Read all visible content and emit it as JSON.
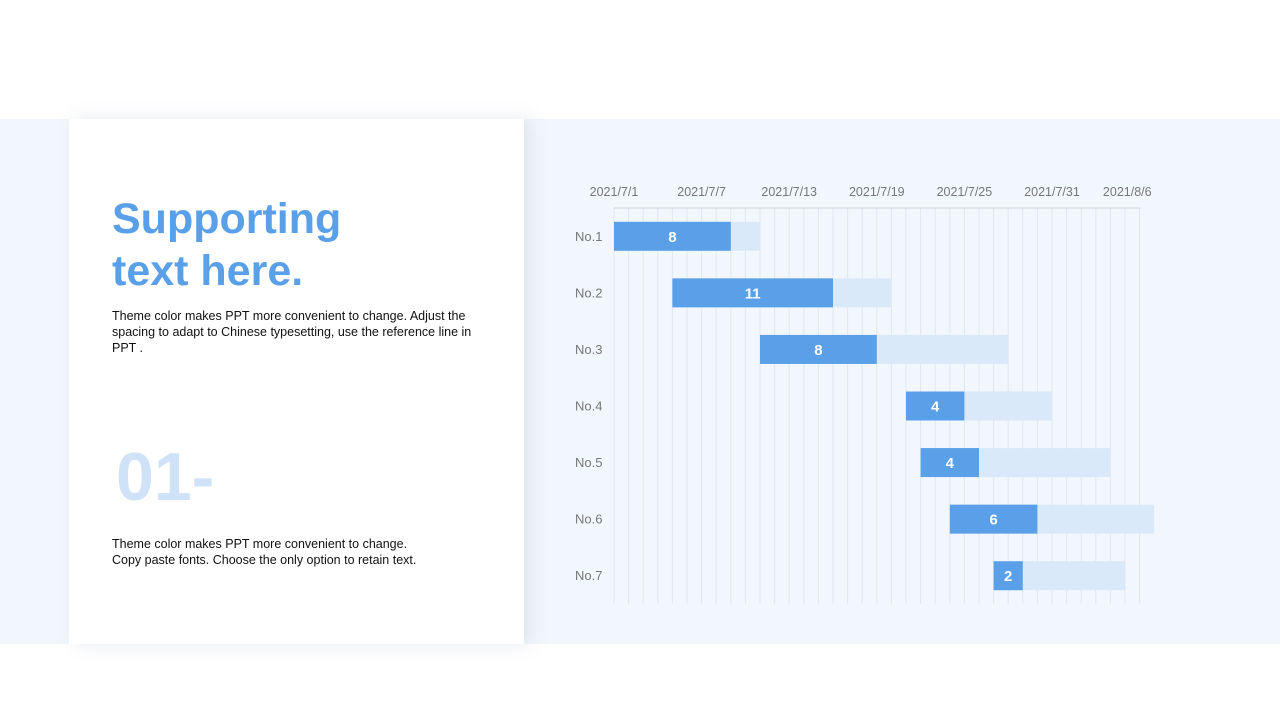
{
  "left_panel": {
    "title_line1": "Supporting",
    "title_line2": "text here.",
    "description": "Theme color makes PPT more convenient to change. Adjust the spacing to adapt to Chinese typesetting, use the reference line in PPT .",
    "number": "01-",
    "footer_text_line1": "Theme color makes PPT more convenient to change.",
    "footer_text_line2": "Copy paste fonts. Choose the only option to retain text."
  },
  "colors": {
    "accent": "#5aa0e8",
    "bar_light": "#dae9f9",
    "number_light": "#cfe2f7",
    "band_bg": "#f2f7fd"
  },
  "chart_data": {
    "type": "bar",
    "orientation": "horizontal-gantt",
    "x_ticks": [
      "2021/7/1",
      "2021/7/7",
      "2021/7/13",
      "2021/7/19",
      "2021/7/25",
      "2021/7/31",
      "2021/8/6"
    ],
    "x_start": "2021/7/1",
    "xlim": [
      "2021/7/1",
      "2021/8/6"
    ],
    "grid": true,
    "tasks": [
      {
        "label": "No.1",
        "start": "2021/7/1",
        "completed_days": 8,
        "end": "2021/7/11"
      },
      {
        "label": "No.2",
        "start": "2021/7/5",
        "completed_days": 11,
        "end": "2021/7/20"
      },
      {
        "label": "No.3",
        "start": "2021/7/11",
        "completed_days": 8,
        "end": "2021/7/28"
      },
      {
        "label": "No.4",
        "start": "2021/7/21",
        "completed_days": 4,
        "end": "2021/7/31"
      },
      {
        "label": "No.5",
        "start": "2021/7/22",
        "completed_days": 4,
        "end": "2021/8/4"
      },
      {
        "label": "No.6",
        "start": "2021/7/24",
        "completed_days": 6,
        "end": "2021/8/7"
      },
      {
        "label": "No.7",
        "start": "2021/7/27",
        "completed_days": 2,
        "end": "2021/8/5"
      }
    ]
  }
}
